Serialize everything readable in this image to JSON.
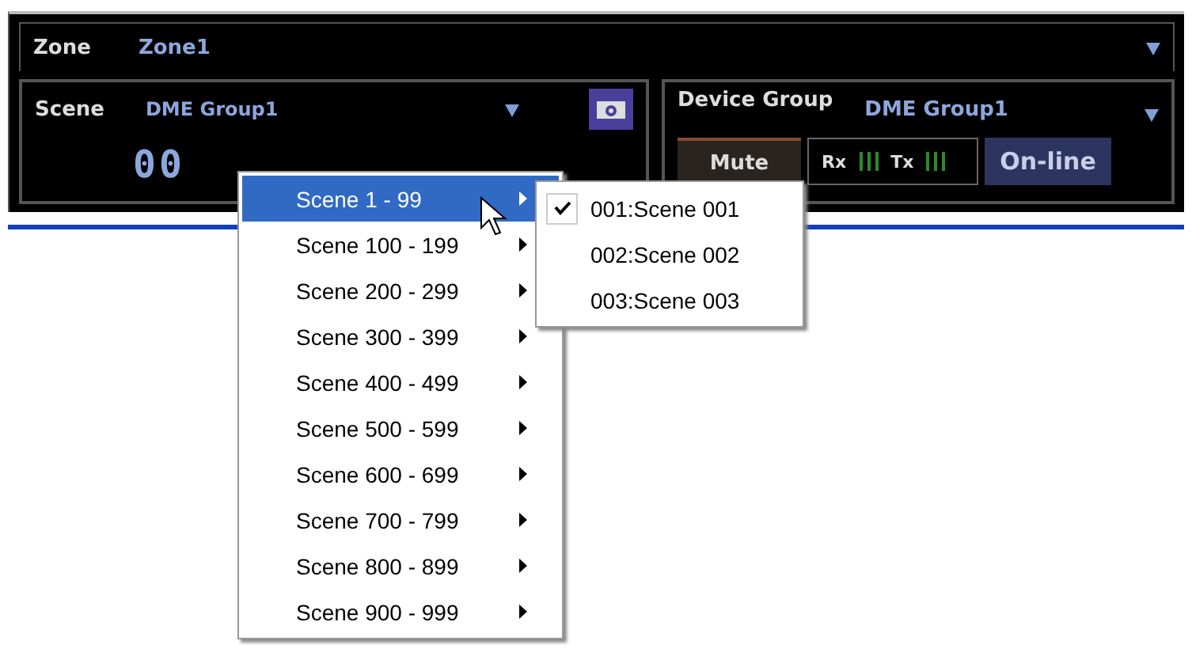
{
  "zone": {
    "label": "Zone",
    "value": "Zone1"
  },
  "scene": {
    "label": "Scene",
    "group": "DME Group1",
    "number": "00"
  },
  "device_group": {
    "label": "Device Group",
    "value": "DME Group1",
    "mute": "Mute",
    "rx": "Rx",
    "tx": "Tx",
    "status": "On-line"
  },
  "scene_menu": [
    {
      "label": "Scene 1 - 99",
      "selected": true
    },
    {
      "label": "Scene 100 - 199",
      "selected": false
    },
    {
      "label": "Scene 200 - 299",
      "selected": false
    },
    {
      "label": "Scene 300 - 399",
      "selected": false
    },
    {
      "label": "Scene 400 - 499",
      "selected": false
    },
    {
      "label": "Scene 500 - 599",
      "selected": false
    },
    {
      "label": "Scene 600 - 699",
      "selected": false
    },
    {
      "label": "Scene 700 - 799",
      "selected": false
    },
    {
      "label": "Scene 800 - 899",
      "selected": false
    },
    {
      "label": "Scene 900 - 999",
      "selected": false
    }
  ],
  "submenu": [
    {
      "label": "001:Scene 001",
      "checked": true
    },
    {
      "label": "002:Scene 002",
      "checked": false
    },
    {
      "label": "003:Scene 003",
      "checked": false
    }
  ]
}
